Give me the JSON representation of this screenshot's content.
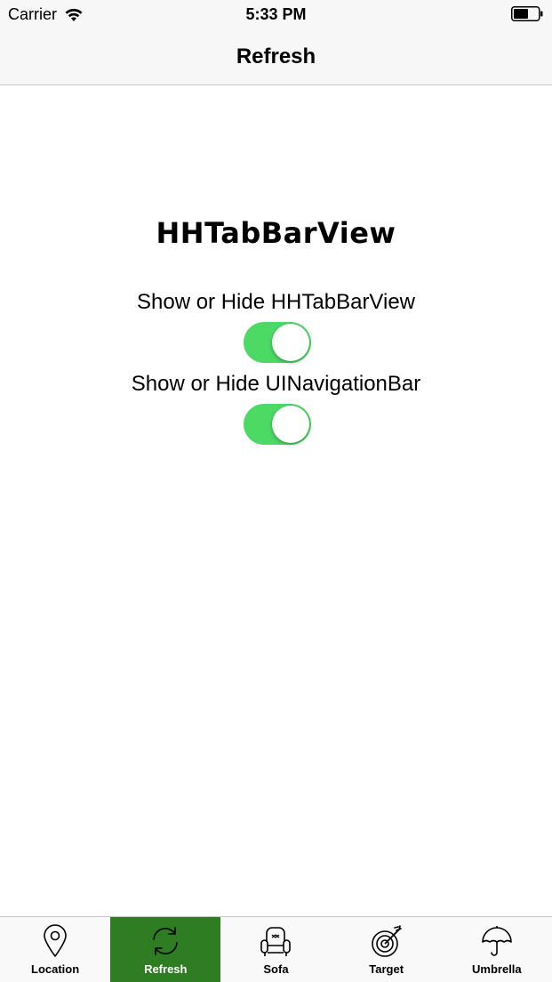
{
  "status_bar": {
    "carrier": "Carrier",
    "time": "5:33 PM"
  },
  "nav": {
    "title": "Refresh"
  },
  "content": {
    "title": "HHTabBarView",
    "toggle_tabbar": {
      "label": "Show or Hide HHTabBarView",
      "on": true
    },
    "toggle_navbar": {
      "label": "Show or Hide UINavigationBar",
      "on": true
    }
  },
  "tab_bar": {
    "active_color": "#2e7d23",
    "tabs": [
      {
        "label": "Location",
        "icon": "location-pin-icon"
      },
      {
        "label": "Refresh",
        "icon": "refresh-icon",
        "active": true
      },
      {
        "label": "Sofa",
        "icon": "sofa-icon"
      },
      {
        "label": "Target",
        "icon": "target-icon"
      },
      {
        "label": "Umbrella",
        "icon": "umbrella-icon"
      }
    ]
  }
}
